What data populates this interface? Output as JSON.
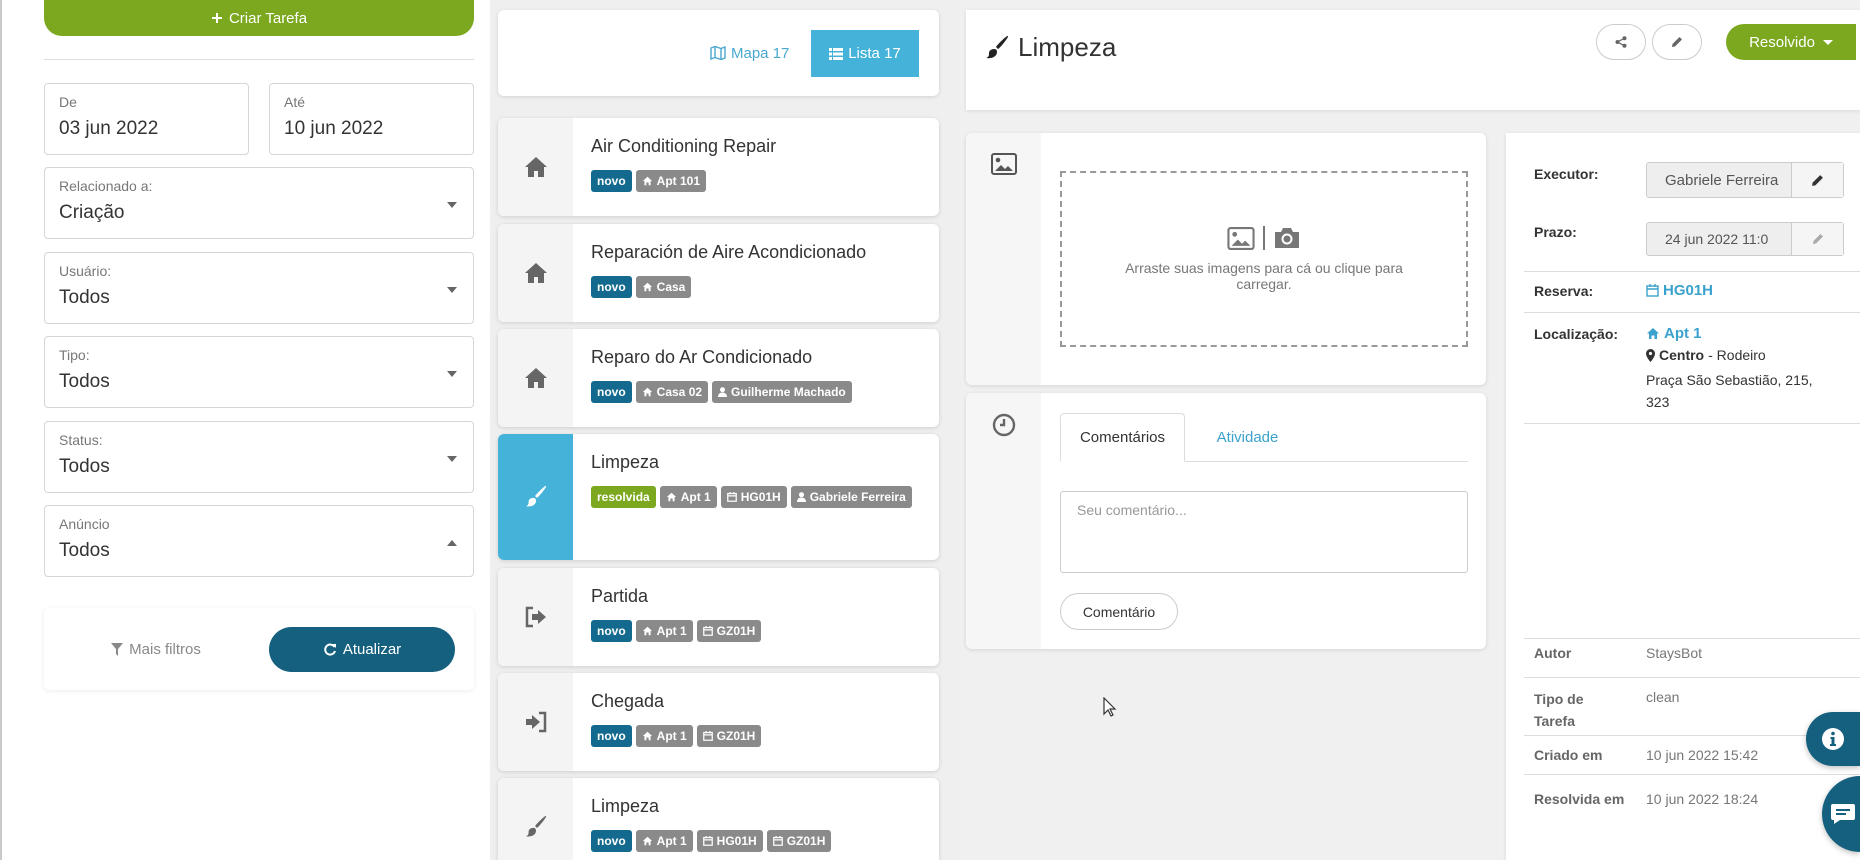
{
  "left": {
    "create_button": "Criar Tarefa",
    "from_label": "De",
    "from_value": "03 jun 2022",
    "to_label": "Até",
    "to_value": "10 jun 2022",
    "related_label": "Relacionado a:",
    "related_value": "Criação",
    "user_label": "Usuário:",
    "user_value": "Todos",
    "type_label": "Tipo:",
    "type_value": "Todos",
    "status_label": "Status:",
    "status_value": "Todos",
    "listing_label": "Anúncio",
    "listing_value": "Todos",
    "more_filters": "Mais filtros",
    "refresh": "Atualizar"
  },
  "mid": {
    "map_label": "Mapa 17",
    "list_label": "Lista 17",
    "tasks": [
      {
        "title": "Air Conditioning Repair",
        "icon": "home-icon",
        "tags": [
          "novo",
          "Apt 101"
        ]
      },
      {
        "title": "Reparación de Aire Acondicionado",
        "icon": "home-icon",
        "tags": [
          "novo",
          "Casa"
        ]
      },
      {
        "title": "Reparo do Ar Condicionado",
        "icon": "home-icon",
        "tags": [
          "novo",
          "Casa 02",
          "Guilherme Machado"
        ]
      },
      {
        "title": "Limpeza",
        "icon": "brush-icon",
        "tags": [
          "resolvida",
          "Apt 1",
          "HG01H",
          "Gabriele Ferreira"
        ]
      },
      {
        "title": "Partida",
        "icon": "sign-out-icon",
        "tags": [
          "novo",
          "Apt 1",
          "GZ01H"
        ]
      },
      {
        "title": "Chegada",
        "icon": "sign-in-icon",
        "tags": [
          "novo",
          "Apt 1",
          "GZ01H"
        ]
      },
      {
        "title": "Limpeza",
        "icon": "brush-icon",
        "tags": [
          "novo",
          "Apt 1",
          "HG01H",
          "GZ01H"
        ]
      }
    ]
  },
  "detail": {
    "title": "Limpeza",
    "status_button": "Resolvido",
    "dropzone_text": "Arraste suas imagens para cá ou clique para carregar.",
    "tab_comments": "Comentários",
    "tab_activity": "Atividade",
    "comment_placeholder": "Seu comentário...",
    "comment_button": "Comentário"
  },
  "info": {
    "executor_label": "Executor:",
    "executor_value": "Gabriele Ferreira",
    "deadline_label": "Prazo:",
    "deadline_value": "24 jun 2022 11:0",
    "booking_label": "Reserva:",
    "booking_value": "HG01H",
    "location_label": "Localização:",
    "location_apt": "Apt 1",
    "location_area": "Centro",
    "location_city": " - Rodeiro",
    "location_address": "Praça São Sebastião, 215, 323",
    "author_label": "Autor",
    "author_value": "StaysBot",
    "type_label": "Tipo de Tarefa",
    "type_value": "clean",
    "created_label": "Criado em",
    "created_value": "10 jun 2022 15:42",
    "resolved_label": "Resolvida em",
    "resolved_value": "10 jun 2022 18:24"
  },
  "colors": {
    "green": "#7ba81e",
    "navy": "#146a8e",
    "cyan": "#45b3d9",
    "tag_gray": "#8a8a8a"
  }
}
